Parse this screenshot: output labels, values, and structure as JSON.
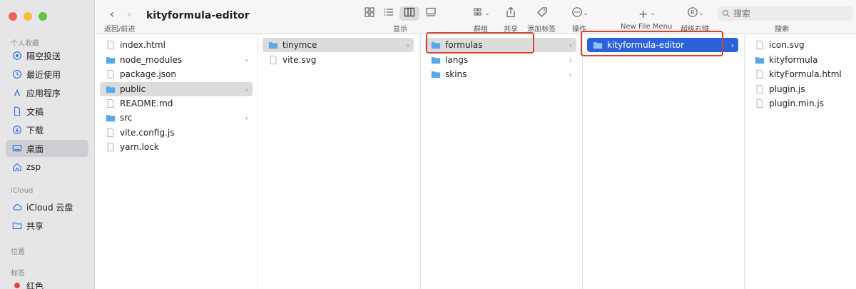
{
  "window": {
    "title": "kityformula-editor"
  },
  "sidebar": {
    "section_favorites": "个人收藏",
    "favorites": [
      {
        "label": "隔空投送",
        "icon": "airdrop-icon"
      },
      {
        "label": "最近使用",
        "icon": "clock-icon"
      },
      {
        "label": "应用程序",
        "icon": "apps-icon"
      },
      {
        "label": "文稿",
        "icon": "document-icon"
      },
      {
        "label": "下载",
        "icon": "download-icon"
      },
      {
        "label": "桌面",
        "icon": "desktop-icon",
        "active": true
      },
      {
        "label": "zsp",
        "icon": "home-icon"
      }
    ],
    "section_icloud": "iCloud",
    "icloud": [
      {
        "label": "iCloud 云盘",
        "icon": "cloud-icon"
      },
      {
        "label": "共享",
        "icon": "shared-folder-icon"
      }
    ],
    "section_locations": "位置",
    "section_tags": "标签",
    "tags": [
      {
        "label": "红色",
        "color": "#e5453a"
      }
    ]
  },
  "toolbar": {
    "back_forward_label": "返回/前进",
    "view_label": "显示",
    "group_label": "群组",
    "share_label": "共享",
    "tag_label": "添加标签",
    "action_label": "操作",
    "new_file_label": "New File Menu",
    "super_right_label": "超级右键",
    "search_label": "搜索",
    "search_placeholder": "搜索"
  },
  "columns": {
    "col1": [
      {
        "name": "index.html",
        "type": "file"
      },
      {
        "name": "node_modules",
        "type": "folder"
      },
      {
        "name": "package.json",
        "type": "file"
      },
      {
        "name": "public",
        "type": "folder",
        "selected": "gray"
      },
      {
        "name": "README.md",
        "type": "file"
      },
      {
        "name": "src",
        "type": "folder"
      },
      {
        "name": "vite.config.js",
        "type": "file"
      },
      {
        "name": "yarn.lock",
        "type": "file"
      }
    ],
    "col2": [
      {
        "name": "tinymce",
        "type": "folder",
        "selected": "gray"
      },
      {
        "name": "vite.svg",
        "type": "file"
      }
    ],
    "col3": [
      {
        "name": "formulas",
        "type": "folder",
        "selected": "gray"
      },
      {
        "name": "langs",
        "type": "folder"
      },
      {
        "name": "skins",
        "type": "folder"
      }
    ],
    "col4": [
      {
        "name": "kityformula-editor",
        "type": "folder",
        "selected": "blue"
      }
    ],
    "col5": [
      {
        "name": "icon.svg",
        "type": "file"
      },
      {
        "name": "kityformula",
        "type": "folder"
      },
      {
        "name": "kityFormula.html",
        "type": "file"
      },
      {
        "name": "plugin.js",
        "type": "file"
      },
      {
        "name": "plugin.min.js",
        "type": "file"
      }
    ]
  },
  "colors": {
    "folder": "#5aa8e8",
    "selection_blue": "#2b62d9",
    "annotation": "#d9432f"
  }
}
